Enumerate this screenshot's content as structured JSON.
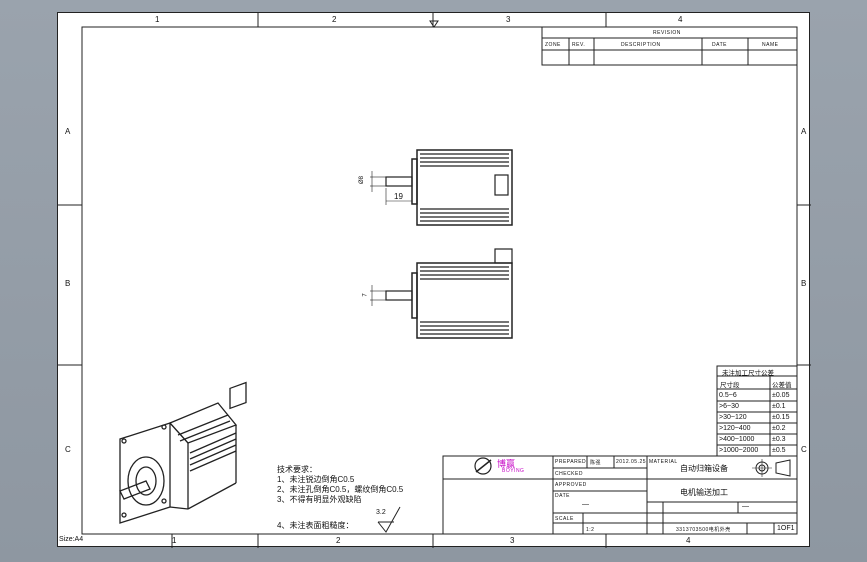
{
  "zones": {
    "columns_top": [
      "1",
      "2",
      "3",
      "4"
    ],
    "columns_bottom": [
      "1",
      "2",
      "3",
      "4"
    ],
    "rows_left": [
      "A",
      "B",
      "C"
    ],
    "rows_right": [
      "A",
      "B",
      "C"
    ]
  },
  "revision_table": {
    "title": "REVISION",
    "headers": [
      "ZONE",
      "REV.",
      "DESCRIPTION",
      "DATE",
      "NAME"
    ]
  },
  "dimensions": {
    "shaft_diameter": "Ø8",
    "shaft_length": "19",
    "flat": "7"
  },
  "tolerance_table": {
    "title": "未注加工尺寸公差",
    "col1": "尺寸段",
    "col2": "公差值",
    "rows": [
      {
        "range": "0.5~6",
        "tol": "±0.05"
      },
      {
        "range": ">6~30",
        "tol": "±0.1"
      },
      {
        "range": ">30~120",
        "tol": "±0.15"
      },
      {
        "range": ">120~400",
        "tol": "±0.2"
      },
      {
        "range": ">400~1000",
        "tol": "±0.3"
      },
      {
        "range": ">1000~2000",
        "tol": "±0.5"
      }
    ]
  },
  "notes": {
    "heading": "技术要求：",
    "items": [
      "1、未注锐边倒角C0.5",
      "2、未注孔倒角C0.5，螺纹倒角C0.5",
      "3、不得有明显外观缺陷",
      "4、未注表面粗糙度："
    ],
    "roughness": "3.2"
  },
  "title_block": {
    "logo_text": "博赢",
    "logo_sub": "BOYING",
    "prepared_label": "PREPARED",
    "checked_label": "CHECKED",
    "approved_label": "APPROVED",
    "date_label": "DATE",
    "date_value": "2012.05.25",
    "designer_value": "陈强",
    "material_label": "MATERIAL",
    "material_value": "—",
    "company": "自动归箱设备",
    "part_name": "电机输送加工",
    "drawing_no": "3313703500电机外壳",
    "sheet_no": "1OF1",
    "scale_label": "SCALE",
    "scale_value": "1:2",
    "weight_value": "—"
  },
  "size_label": "Size:A4"
}
